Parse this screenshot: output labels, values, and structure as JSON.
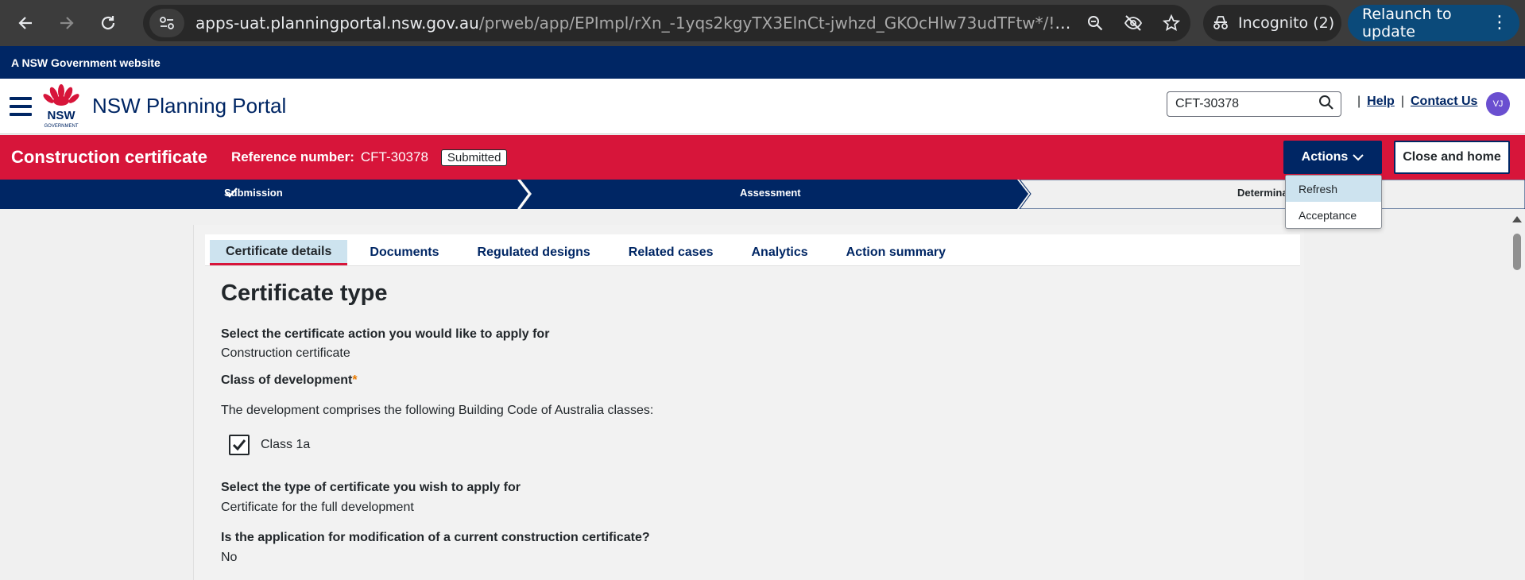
{
  "browser": {
    "url_host": "apps-uat.planningportal.nsw.gov.au",
    "url_path": "/prweb/app/EPImpl/rXn_-1yqs2kgyTX3ElnCt-jwhzd_GKOcHlw73udTFtw*/!STAND...",
    "incognito_label": "Incognito (2)",
    "relaunch_label": "Relaunch to update"
  },
  "gov_banner": "A NSW Government website",
  "header": {
    "logo_text": "NSW",
    "logo_subtext": "GOVERNMENT",
    "title": "NSW Planning Portal",
    "search_value": "CFT-30378",
    "help_label": "Help",
    "contact_label": "Contact Us",
    "avatar_initials": "VJ"
  },
  "case": {
    "title": "Construction certificate",
    "ref_label": "Reference number:",
    "ref_value": "CFT-30378",
    "status": "Submitted",
    "actions_label": "Actions",
    "close_label": "Close and home"
  },
  "stages": [
    {
      "label": "Submission",
      "complete": true
    },
    {
      "label": "Assessment",
      "complete": false
    },
    {
      "label": "Determina",
      "complete": false
    }
  ],
  "actions_menu": [
    "Refresh",
    "Acceptance"
  ],
  "tabs": [
    "Certificate details",
    "Documents",
    "Regulated designs",
    "Related cases",
    "Analytics",
    "Action summary"
  ],
  "form": {
    "heading": "Certificate type",
    "q1_label": "Select the certificate action you would like to apply for",
    "q1_value": "Construction certificate",
    "q2_label": "Class of development",
    "q2_required": "*",
    "q2_text": "The development comprises the following Building Code of Australia classes:",
    "class_checkbox_label": "Class 1a",
    "q3_label": "Select the type of certificate you wish to apply for",
    "q3_value": "Certificate for the full development",
    "q4_label": "Is the application for modification of a current construction certificate?",
    "q4_value": "No"
  },
  "colors": {
    "nsw_navy": "#002664",
    "nsw_red": "#d7153a",
    "tab_highlight": "#cde3ef"
  }
}
